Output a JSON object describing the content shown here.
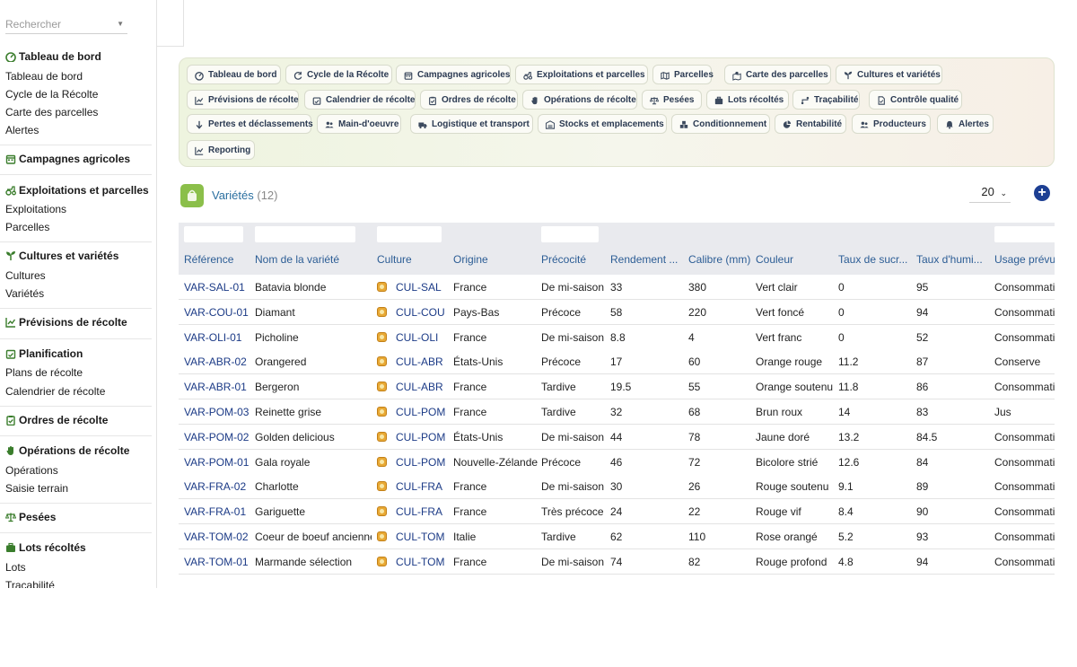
{
  "sidebar": {
    "search_placeholder": "Rechercher",
    "sections": [
      {
        "title": "Tableau de bord",
        "icon": "dashboard-icon",
        "items": [
          "Tableau de bord",
          "Cycle de la Récolte",
          "Carte des parcelles",
          "Alertes"
        ]
      },
      {
        "title": "Campagnes agricoles",
        "icon": "calendar-icon",
        "items": []
      },
      {
        "title": "Exploitations et parcelles",
        "icon": "tractor-icon",
        "items": [
          "Exploitations",
          "Parcelles"
        ]
      },
      {
        "title": "Cultures et variétés",
        "icon": "seedling-icon",
        "items": [
          "Cultures",
          "Variétés"
        ]
      },
      {
        "title": "Prévisions de récolte",
        "icon": "chart-line-icon",
        "items": []
      },
      {
        "title": "Planification",
        "icon": "calendar-check-icon",
        "items": [
          "Plans de récolte",
          "Calendrier de récolte"
        ]
      },
      {
        "title": "Ordres de récolte",
        "icon": "clipboard-check-icon",
        "items": []
      },
      {
        "title": "Opérations de récolte",
        "icon": "hand-icon",
        "items": [
          "Opérations",
          "Saisie terrain"
        ]
      },
      {
        "title": "Pesées",
        "icon": "scale-icon",
        "items": []
      },
      {
        "title": "Lots récoltés",
        "icon": "suitcase-icon",
        "items": [
          "Lots",
          "Traçabilité"
        ]
      }
    ]
  },
  "nav": [
    {
      "label": "Tableau de bord",
      "icon": "dashboard-icon"
    },
    {
      "label": "Cycle de la Récolte",
      "icon": "refresh-icon"
    },
    {
      "label": "Campagnes agricoles",
      "icon": "calendar-icon"
    },
    {
      "label": "Exploitations et parcelles",
      "icon": "tractor-icon"
    },
    {
      "label": "Parcelles",
      "icon": "map-icon"
    },
    {
      "label": "Carte des parcelles",
      "icon": "map-marked-icon"
    },
    {
      "label": "Cultures et variétés",
      "icon": "seedling-icon"
    },
    {
      "label": "Prévisions de récolte",
      "icon": "chart-line-icon"
    },
    {
      "label": "Calendrier de récolte",
      "icon": "calendar-check-icon"
    },
    {
      "label": "Ordres de récolte",
      "icon": "clipboard-check-icon"
    },
    {
      "label": "Opérations de récolte",
      "icon": "hand-icon"
    },
    {
      "label": "Pesées",
      "icon": "scale-icon"
    },
    {
      "label": "Lots récoltés",
      "icon": "suitcase-icon"
    },
    {
      "label": "Traçabilité",
      "icon": "route-icon"
    },
    {
      "label": "Contrôle qualité",
      "icon": "file-check-icon"
    },
    {
      "label": "Pertes et déclassements",
      "icon": "arrow-down-icon"
    },
    {
      "label": "Main-d'oeuvre",
      "icon": "users-icon"
    },
    {
      "label": "Logistique et transport",
      "icon": "truck-icon"
    },
    {
      "label": "Stocks et emplacements",
      "icon": "warehouse-icon"
    },
    {
      "label": "Conditionnement",
      "icon": "boxes-icon"
    },
    {
      "label": "Rentabilité",
      "icon": "pie-icon"
    },
    {
      "label": "Producteurs",
      "icon": "users-icon"
    },
    {
      "label": "Alertes",
      "icon": "bell-icon"
    },
    {
      "label": "Reporting",
      "icon": "chart-line-icon"
    }
  ],
  "page": {
    "title": "Variétés",
    "count": "(12)",
    "page_size": "20"
  },
  "table": {
    "columns": [
      "Référence",
      "Nom de la variété",
      "Culture",
      "Origine",
      "Précocité",
      "Rendement ...",
      "Calibre (mm)",
      "Couleur",
      "Taux de sucr...",
      "Taux d'humi...",
      "Usage prévu"
    ],
    "rows": [
      [
        "VAR-SAL-01",
        "Batavia blonde",
        "CUL-SAL",
        "France",
        "De mi-saison",
        "33",
        "380",
        "Vert clair",
        "0",
        "95",
        "Consommation"
      ],
      [
        "VAR-COU-01",
        "Diamant",
        "CUL-COU",
        "Pays-Bas",
        "Précoce",
        "58",
        "220",
        "Vert foncé",
        "0",
        "94",
        "Consommation"
      ],
      [
        "VAR-OLI-01",
        "Picholine",
        "CUL-OLI",
        "France",
        "De mi-saison",
        "8.8",
        "4",
        "Vert franc",
        "0",
        "52",
        "Consommation"
      ],
      [
        "VAR-ABR-02",
        "Orangered",
        "CUL-ABR",
        "États-Unis",
        "Précoce",
        "17",
        "60",
        "Orange rouge",
        "11.2",
        "87",
        "Conserve"
      ],
      [
        "VAR-ABR-01",
        "Bergeron",
        "CUL-ABR",
        "France",
        "Tardive",
        "19.5",
        "55",
        "Orange soutenu",
        "11.8",
        "86",
        "Consommation"
      ],
      [
        "VAR-POM-03",
        "Reinette grise",
        "CUL-POM",
        "France",
        "Tardive",
        "32",
        "68",
        "Brun roux",
        "14",
        "83",
        "Jus"
      ],
      [
        "VAR-POM-02",
        "Golden delicious",
        "CUL-POM",
        "États-Unis",
        "De mi-saison",
        "44",
        "78",
        "Jaune doré",
        "13.2",
        "84.5",
        "Consommation"
      ],
      [
        "VAR-POM-01",
        "Gala royale",
        "CUL-POM",
        "Nouvelle-Zélande",
        "Précoce",
        "46",
        "72",
        "Bicolore strié",
        "12.6",
        "84",
        "Consommation"
      ],
      [
        "VAR-FRA-02",
        "Charlotte",
        "CUL-FRA",
        "France",
        "De mi-saison",
        "30",
        "26",
        "Rouge soutenu",
        "9.1",
        "89",
        "Consommation"
      ],
      [
        "VAR-FRA-01",
        "Gariguette",
        "CUL-FRA",
        "France",
        "Très précoce",
        "24",
        "22",
        "Rouge vif",
        "8.4",
        "90",
        "Consommation"
      ],
      [
        "VAR-TOM-02",
        "Coeur de boeuf ancienne",
        "CUL-TOM",
        "Italie",
        "Tardive",
        "62",
        "110",
        "Rose orangé",
        "5.2",
        "93",
        "Consommation"
      ],
      [
        "VAR-TOM-01",
        "Marmande sélection",
        "CUL-TOM",
        "France",
        "De mi-saison",
        "74",
        "82",
        "Rouge profond",
        "4.8",
        "94",
        "Consommation"
      ]
    ]
  }
}
